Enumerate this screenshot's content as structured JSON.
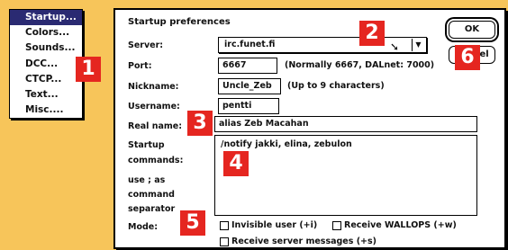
{
  "menu": {
    "items": [
      {
        "label": "Startup...",
        "selected": true
      },
      {
        "label": "Colors...",
        "selected": false
      },
      {
        "label": "Sounds...",
        "selected": false
      },
      {
        "label": "DCC...",
        "selected": false
      },
      {
        "label": "CTCP...",
        "selected": false
      },
      {
        "label": "Text...",
        "selected": false
      },
      {
        "label": "Misc....",
        "selected": false
      }
    ]
  },
  "dialog": {
    "title": "Startup preferences",
    "server": {
      "label": "Server:",
      "value": "irc.funet.fi"
    },
    "port": {
      "label": "Port:",
      "value": "6667",
      "hint": "(Normally 6667, DALnet: 7000)"
    },
    "nickname": {
      "label": "Nickname:",
      "value": "Uncle_Zeb",
      "hint": "(Up to 9 characters)"
    },
    "username": {
      "label": "Username:",
      "value": "pentti"
    },
    "realname": {
      "label": "Real name:",
      "value": "alias Zeb Macahan"
    },
    "startup": {
      "label_line1": "Startup",
      "label_line2": "commands:",
      "sep_line1": "use ; as",
      "sep_line2": "command",
      "sep_line3": "separator",
      "value": "/notify jakki, elina, zebulon"
    },
    "mode": {
      "label": "Mode:",
      "invisible": "Invisible user (+i)",
      "wallops": "Receive WALLOPS (+w)",
      "server_messages": "Receive server messages (+s)"
    },
    "ok_label": "OK",
    "cancel_label": "Cancel"
  },
  "badges": [
    "1",
    "2",
    "3",
    "4",
    "5",
    "6"
  ],
  "colors": {
    "background": "#f7c55a",
    "badge": "#e52620",
    "menu_selected": "#2a2a72"
  }
}
